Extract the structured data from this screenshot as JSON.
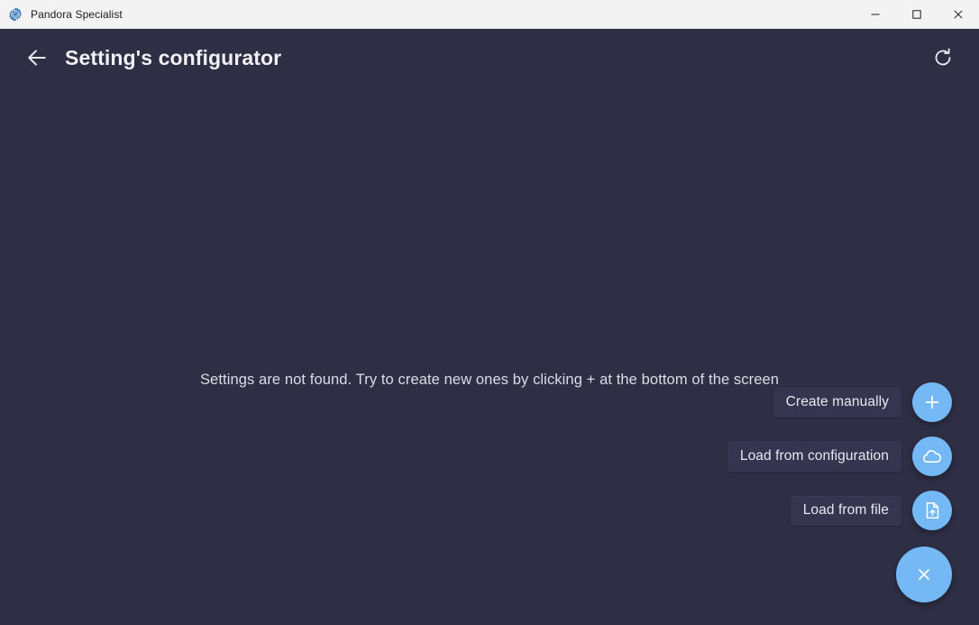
{
  "window": {
    "title": "Pandora Specialist",
    "app_icon": "gear-lock-icon",
    "controls": {
      "minimize": "minimize-icon",
      "maximize": "maximize-icon",
      "close": "close-icon"
    }
  },
  "header": {
    "back_icon": "arrow-left-icon",
    "title": "Setting's configurator",
    "refresh_icon": "refresh-icon"
  },
  "main": {
    "empty_message": "Settings are not found. Try to create new ones by clicking + at the bottom of the screen"
  },
  "speed_dial": {
    "actions": [
      {
        "label": "Create manually",
        "icon": "plus-icon"
      },
      {
        "label": "Load from configuration",
        "icon": "cloud-icon"
      },
      {
        "label": "Load from file",
        "icon": "file-upload-icon"
      }
    ],
    "main_button": {
      "icon": "close-icon",
      "state": "expanded"
    }
  },
  "colors": {
    "background": "#2e2e45",
    "titlebar": "#f3f3f3",
    "accent": "#74b8f5",
    "chip": "#353550",
    "text": "#dcdce6",
    "heading": "#f0f0f5"
  }
}
